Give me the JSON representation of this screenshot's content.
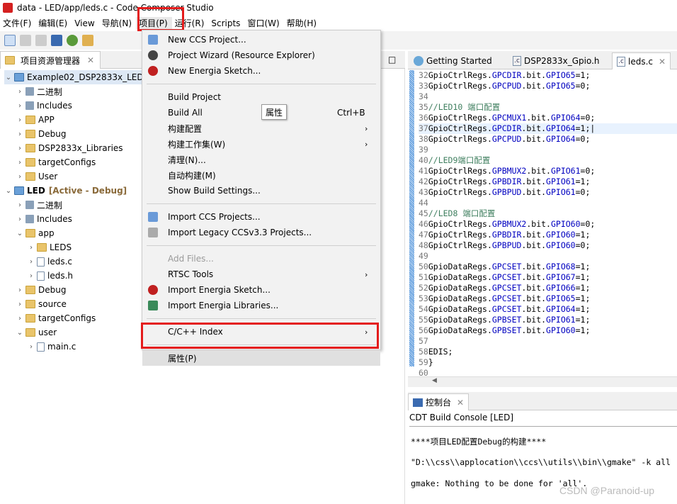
{
  "window": {
    "title": "data - LED/app/leds.c - Code Composer Studio"
  },
  "menubar": [
    "文件(F)",
    "编辑(E)",
    "View",
    "导航(N)",
    "项目(P)",
    "运行(R)",
    "Scripts",
    "窗口(W)",
    "帮助(H)"
  ],
  "explorer": {
    "tab": "项目资源管理器",
    "items": [
      {
        "label": "Example02_DSP2833x_LED",
        "depth": 0,
        "open": true,
        "icon": "project",
        "selected": true
      },
      {
        "label": "二进制",
        "depth": 1,
        "icon": "binary"
      },
      {
        "label": "Includes",
        "depth": 1,
        "icon": "includes"
      },
      {
        "label": "APP",
        "depth": 1,
        "icon": "folder"
      },
      {
        "label": "Debug",
        "depth": 1,
        "icon": "folder"
      },
      {
        "label": "DSP2833x_Libraries",
        "depth": 1,
        "icon": "folder"
      },
      {
        "label": "targetConfigs",
        "depth": 1,
        "icon": "folder"
      },
      {
        "label": "User",
        "depth": 1,
        "icon": "folder"
      },
      {
        "label": "LED",
        "suffix": "[Active - Debug]",
        "depth": 0,
        "open": true,
        "icon": "project"
      },
      {
        "label": "二进制",
        "depth": 1,
        "icon": "binary"
      },
      {
        "label": "Includes",
        "depth": 1,
        "icon": "includes"
      },
      {
        "label": "app",
        "depth": 1,
        "open": true,
        "icon": "folder"
      },
      {
        "label": "LEDS",
        "depth": 2,
        "icon": "folder"
      },
      {
        "label": "leds.c",
        "depth": 2,
        "icon": "file"
      },
      {
        "label": "leds.h",
        "depth": 2,
        "icon": "file"
      },
      {
        "label": "Debug",
        "depth": 1,
        "icon": "folder"
      },
      {
        "label": "source",
        "depth": 1,
        "icon": "folder"
      },
      {
        "label": "targetConfigs",
        "depth": 1,
        "icon": "folder"
      },
      {
        "label": "user",
        "depth": 1,
        "open": true,
        "icon": "folder"
      },
      {
        "label": "main.c",
        "depth": 2,
        "icon": "file"
      }
    ]
  },
  "project_menu": {
    "items": [
      {
        "label": "New CCS Project...",
        "icon": "new-project"
      },
      {
        "label": "Project Wizard (Resource Explorer)",
        "icon": "compass"
      },
      {
        "label": "New Energia Sketch...",
        "icon": "energia"
      },
      {
        "sep": true
      },
      {
        "label": "Build Project"
      },
      {
        "label": "Build All",
        "shortcut": "Ctrl+B"
      },
      {
        "label": "构建配置",
        "submenu": true
      },
      {
        "label": "构建工作集(W)",
        "submenu": true
      },
      {
        "label": "清理(N)..."
      },
      {
        "label": "自动构建(M)"
      },
      {
        "label": "Show Build Settings..."
      },
      {
        "sep": true
      },
      {
        "label": "Import CCS Projects...",
        "icon": "import"
      },
      {
        "label": "Import Legacy CCSv3.3 Projects...",
        "icon": "import-legacy"
      },
      {
        "sep": true
      },
      {
        "label": "Add Files...",
        "disabled": true
      },
      {
        "label": "RTSC Tools",
        "submenu": true
      },
      {
        "label": "Import Energia Sketch...",
        "icon": "energia"
      },
      {
        "label": "Import Energia Libraries...",
        "icon": "library"
      },
      {
        "sep": true
      },
      {
        "label": "C/C++ Index",
        "submenu": true
      },
      {
        "sep": true
      },
      {
        "label": "属性(P)",
        "highlighted": true
      }
    ]
  },
  "tooltip": "属性",
  "editor": {
    "tabs": [
      "Getting Started",
      "DSP2833x_Gpio.h",
      "leds.c"
    ],
    "active_tab": 2,
    "lines": [
      {
        "n": "32",
        "obj": "GpioCtrlRegs.",
        "reg": "GPCDIR",
        "mid": ".bit.",
        "field": "GPIO65",
        "val": "=1;"
      },
      {
        "n": "33",
        "obj": "GpioCtrlRegs.",
        "reg": "GPCPUD",
        "mid": ".bit.",
        "field": "GPIO65",
        "val": "=0;"
      },
      {
        "n": "34"
      },
      {
        "n": "35",
        "comment": "//LED10 端口配置"
      },
      {
        "n": "36",
        "obj": "GpioCtrlRegs.",
        "reg": "GPCMUX1",
        "mid": ".bit.",
        "field": "GPIO64",
        "val": "=0;"
      },
      {
        "n": "37",
        "obj": "GpioCtrlRegs.",
        "reg": "GPCDIR",
        "mid": ".bit.",
        "field": "GPIO64",
        "val": "=1;",
        "current": true
      },
      {
        "n": "38",
        "obj": "GpioCtrlRegs.",
        "reg": "GPCPUD",
        "mid": ".bit.",
        "field": "GPIO64",
        "val": "=0;"
      },
      {
        "n": "39"
      },
      {
        "n": "40",
        "comment": "//LED9端口配置"
      },
      {
        "n": "41",
        "obj": "GpioCtrlRegs.",
        "reg": "GPBMUX2",
        "mid": ".bit.",
        "field": "GPIO61",
        "val": "=0;"
      },
      {
        "n": "42",
        "obj": "GpioCtrlRegs.",
        "reg": "GPBDIR",
        "mid": ".bit.",
        "field": "GPIO61",
        "val": "=1;"
      },
      {
        "n": "43",
        "obj": "GpioCtrlRegs.",
        "reg": "GPBPUD",
        "mid": ".bit.",
        "field": "GPIO61",
        "val": "=0;"
      },
      {
        "n": "44"
      },
      {
        "n": "45",
        "comment": "//LED8 端口配置"
      },
      {
        "n": "46",
        "obj": "GpioCtrlRegs.",
        "reg": "GPBMUX2",
        "mid": ".bit.",
        "field": "GPIO60",
        "val": "=0;"
      },
      {
        "n": "47",
        "obj": "GpioCtrlRegs.",
        "reg": "GPBDIR",
        "mid": ".bit.",
        "field": "GPIO60",
        "val": "=1;"
      },
      {
        "n": "48",
        "obj": "GpioCtrlRegs.",
        "reg": "GPBPUD",
        "mid": ".bit.",
        "field": "GPIO60",
        "val": "=0;"
      },
      {
        "n": "49"
      },
      {
        "n": "50",
        "obj": "GpioDataRegs.",
        "reg": "GPCSET",
        "mid": ".bit.",
        "field": "GPIO68",
        "val": "=1;"
      },
      {
        "n": "51",
        "obj": "GpioDataRegs.",
        "reg": "GPCSET",
        "mid": ".bit.",
        "field": "GPIO67",
        "val": "=1;"
      },
      {
        "n": "52",
        "obj": "GpioDataRegs.",
        "reg": "GPCSET",
        "mid": ".bit.",
        "field": "GPIO66",
        "val": "=1;"
      },
      {
        "n": "53",
        "obj": "GpioDataRegs.",
        "reg": "GPCSET",
        "mid": ".bit.",
        "field": "GPIO65",
        "val": "=1;"
      },
      {
        "n": "54",
        "obj": "GpioDataRegs.",
        "reg": "GPCSET",
        "mid": ".bit.",
        "field": "GPIO64",
        "val": "=1;"
      },
      {
        "n": "55",
        "obj": "GpioDataRegs.",
        "reg": "GPBSET",
        "mid": ".bit.",
        "field": "GPIO61",
        "val": "=1;"
      },
      {
        "n": "56",
        "obj": "GpioDataRegs.",
        "reg": "GPBSET",
        "mid": ".bit.",
        "field": "GPIO60",
        "val": "=1;"
      },
      {
        "n": "57"
      },
      {
        "n": "58",
        "plain": "EDIS;"
      },
      {
        "n": "59",
        "plain": "}"
      },
      {
        "n": "60"
      }
    ]
  },
  "console": {
    "tab": "控制台",
    "title": "CDT Build Console [LED]",
    "lines": [
      "****项目LED配置Debug的构建****",
      "\"D:\\\\css\\\\applocation\\\\ccs\\\\utils\\\\bin\\\\gmake\" -k all",
      "gmake: Nothing to be done for 'all'."
    ]
  },
  "watermark": "CSDN @Paranoid-up"
}
